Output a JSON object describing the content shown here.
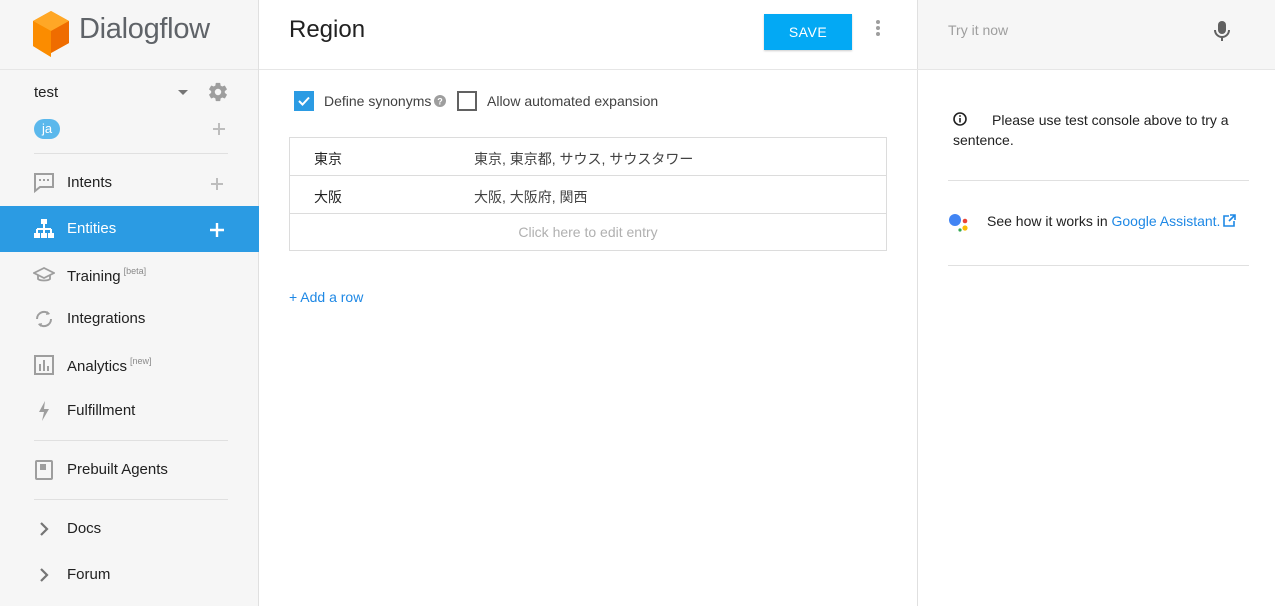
{
  "brand": {
    "name": "Dialogflow",
    "accent": "#ff9800"
  },
  "sidebar": {
    "agent_name": "test",
    "language": "ja",
    "nav": [
      {
        "label": "Intents",
        "sup": ""
      },
      {
        "label": "Entities",
        "sup": ""
      },
      {
        "label": "Training",
        "sup": "[beta]"
      },
      {
        "label": "Integrations",
        "sup": ""
      },
      {
        "label": "Analytics",
        "sup": "[new]"
      },
      {
        "label": "Fulfillment",
        "sup": ""
      },
      {
        "label": "Prebuilt Agents",
        "sup": ""
      },
      {
        "label": "Docs",
        "sup": ""
      },
      {
        "label": "Forum",
        "sup": ""
      }
    ],
    "active_item": "Entities",
    "active_color": "#2b9be3"
  },
  "main": {
    "title": "Region",
    "save_label": "SAVE",
    "options": {
      "define_synonyms": {
        "label": "Define synonyms",
        "checked": true
      },
      "automated_expansion": {
        "label": "Allow automated expansion",
        "checked": false
      }
    },
    "entries": [
      {
        "reference": "東京",
        "synonyms": "東京, 東京都, サウス, サウスタワー"
      },
      {
        "reference": "大阪",
        "synonyms": "大阪, 大阪府, 関西"
      }
    ],
    "edit_placeholder": "Click here to edit entry",
    "add_row_label": "+ Add a row"
  },
  "right_panel": {
    "try_placeholder": "Try it now",
    "info_text": "Please use test console above to try a sentence.",
    "ga_prefix": "See how it works in ",
    "ga_link": "Google Assistant."
  }
}
